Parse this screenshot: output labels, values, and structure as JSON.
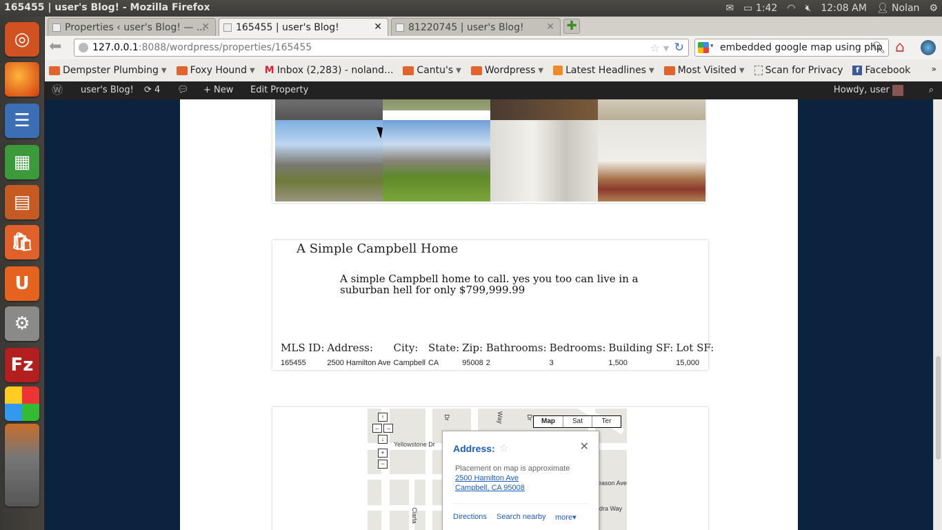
{
  "window": {
    "title": "165455 | user's Blog! - Mozilla Firefox"
  },
  "tray": {
    "battery": "1:42",
    "clock": "12:08 AM",
    "user": "Nolan"
  },
  "tabs": [
    {
      "label": "Properties ‹ user's Blog! — ...",
      "active": false
    },
    {
      "label": "165455 | user's Blog!",
      "active": true
    },
    {
      "label": "81220745 | user's Blog!",
      "active": false
    }
  ],
  "nav": {
    "url_host": "127.0.0.1",
    "url_rest": ":8088/wordpress/properties/165455",
    "search_value": "embedded google map using php"
  },
  "bookmarks": [
    {
      "label": "Dempster Plumbing",
      "menu": true,
      "icon": "folder-icon"
    },
    {
      "label": "Foxy Hound",
      "menu": true,
      "icon": "folder-icon"
    },
    {
      "label": "Inbox (2,283) - noland...",
      "menu": false,
      "icon": "gmail-icon"
    },
    {
      "label": "Cantu's",
      "menu": true,
      "icon": "folder-icon"
    },
    {
      "label": "Wordpress",
      "menu": true,
      "icon": "folder-icon"
    },
    {
      "label": "Latest Headlines",
      "menu": true,
      "icon": "rss-icon"
    },
    {
      "label": "Most Visited",
      "menu": true,
      "icon": "folder-icon"
    },
    {
      "label": "Scan for Privacy",
      "menu": false,
      "icon": "page-icon"
    },
    {
      "label": "Facebook",
      "menu": false,
      "icon": "facebook-icon"
    }
  ],
  "adminbar": {
    "site": "user's Blog!",
    "updates": "4",
    "new_label": "New",
    "edit_label": "Edit Property",
    "howdy": "Howdy, user"
  },
  "property": {
    "title": "A Simple Campbell Home",
    "description": "A simple Campbell home to call. yes you too can live in a suburban hell for only $799,999.99",
    "headers": [
      "MLS ID:",
      "Address:",
      "City:",
      "State:",
      "Zip:",
      "Bathrooms:",
      "Bedrooms:",
      "Building SF:",
      "Lot SF:"
    ],
    "values": [
      "165455",
      "2500 Hamilton Ave",
      "Campbell",
      "CA",
      "95008",
      "2",
      "3",
      "1,500",
      "15,000"
    ]
  },
  "map": {
    "types": [
      "Map",
      "Sat",
      "Ter"
    ],
    "streets": [
      "Yellowstone Dr",
      "Dr",
      "Way",
      "Dr",
      "eason Ave",
      "dra Way",
      "Ciarla"
    ],
    "bubble": {
      "title": "Address:",
      "approx": "Placement on map is approximate",
      "line1": "2500 Hamilton Ave",
      "line2": "Campbell, CA 95008",
      "links": [
        "Directions",
        "Search nearby",
        "more"
      ]
    }
  },
  "colors": {
    "page_bg": "#0c2340",
    "wp_bar": "#222222",
    "link": "#1a5cbf"
  }
}
